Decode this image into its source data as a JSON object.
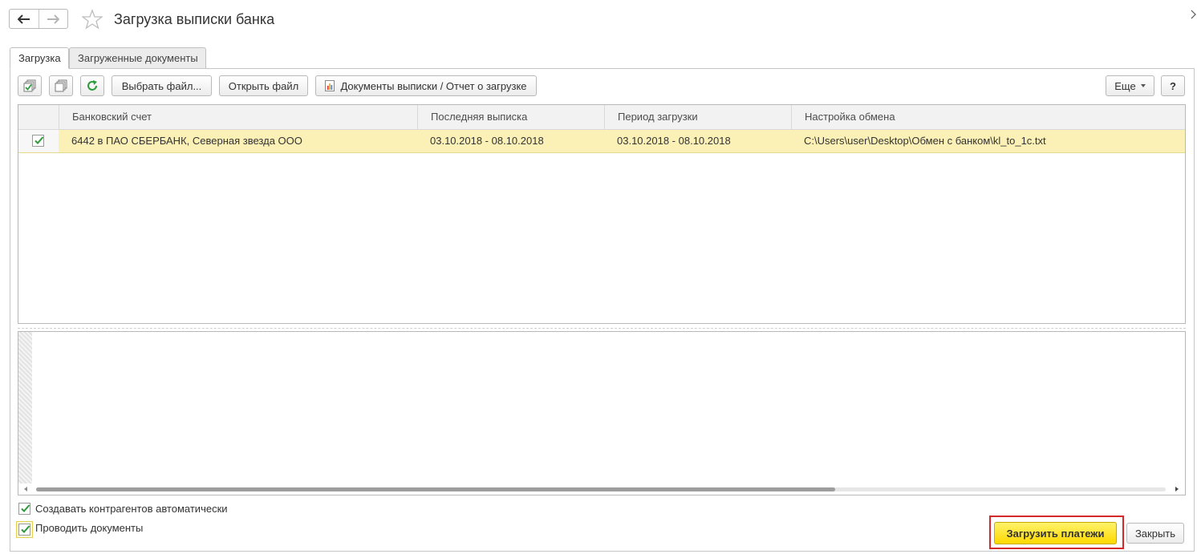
{
  "window": {
    "title": "Загрузка выписки банка"
  },
  "tabs": [
    {
      "label": "Загрузка",
      "active": true
    },
    {
      "label": "Загруженные документы",
      "active": false
    }
  ],
  "toolbar": {
    "select_file": "Выбрать файл...",
    "open_file": "Открыть файл",
    "documents_report": "Документы выписки / Отчет о загрузке",
    "more": "Еще",
    "help": "?"
  },
  "grid": {
    "columns": [
      "Банковский счет",
      "Последняя выписка",
      "Период загрузки",
      "Настройка обмена"
    ],
    "rows": [
      {
        "checked": true,
        "account": "6442 в ПАО СБЕРБАНК, Северная звезда ООО",
        "last_statement": "03.10.2018 - 08.10.2018",
        "period": "03.10.2018 - 08.10.2018",
        "exchange_setting": "C:\\Users\\user\\Desktop\\Обмен с банком\\kl_to_1c.txt"
      }
    ]
  },
  "options": {
    "create_counterparties": {
      "label": "Создавать контрагентов автоматически",
      "checked": true
    },
    "post_documents": {
      "label": "Проводить документы",
      "checked": true
    }
  },
  "actions": {
    "load_payments": "Загрузить платежи",
    "close": "Закрыть"
  },
  "colors": {
    "selected_row": "#fbf1b7",
    "primary_button": "#ffd900",
    "highlight_frame": "#d62828",
    "check_green": "#2e9b3a"
  }
}
